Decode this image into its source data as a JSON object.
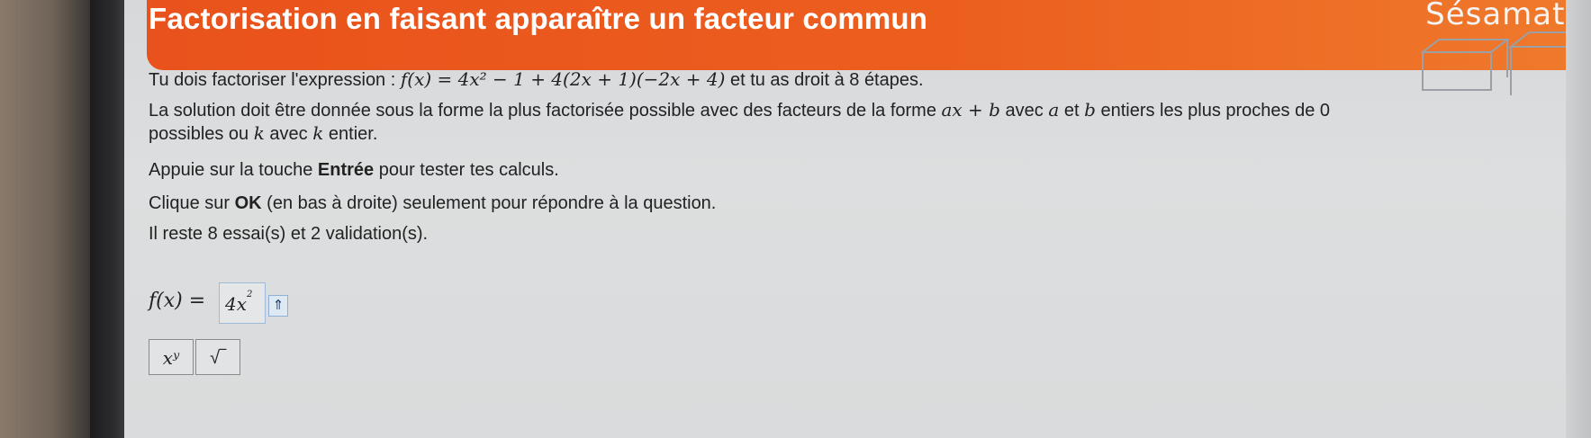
{
  "banner": {
    "title": "Factorisation en faisant apparaître un facteur commun",
    "brand": "Sésamath"
  },
  "instructions": {
    "line1_prefix": "Tu dois factoriser l'expression : ",
    "expression": "f(x) = 4x² − 1 + 4(2x + 1)(−2x + 4)",
    "line1_suffix": " et tu as droit à 8 étapes.",
    "line2a": "La solution doit être donnée sous la forme la plus factorisée possible avec des facteurs de la forme ",
    "line2_form": "ax + b",
    "line2b": " avec ",
    "line2_a": "a",
    "line2c": " et ",
    "line2_b": "b",
    "line2d": " entiers les plus proches de 0",
    "line3a": "possibles ou ",
    "line3_k": "k",
    "line3b": " avec ",
    "line3_k2": "k",
    "line3c": " entier.",
    "enter_a": "Appuie sur la touche ",
    "enter_key": "Entrée",
    "enter_b": " pour tester tes calculs.",
    "ok_a": "Clique sur ",
    "ok_key": "OK",
    "ok_b": " (en bas à droite) seulement pour répondre à la question.",
    "remaining": "Il reste 8 essai(s) et 2 validation(s)."
  },
  "answer": {
    "label": "f(x) =",
    "value": "4x",
    "exponent": "2",
    "caret_symbol": "⇑"
  },
  "keypad": {
    "power_key": "xʸ",
    "sqrt_key": "√‾"
  }
}
